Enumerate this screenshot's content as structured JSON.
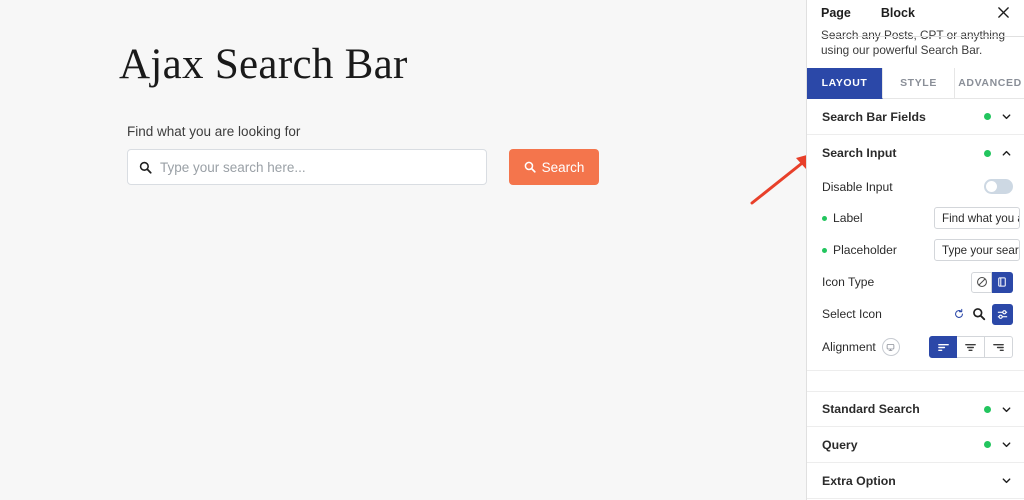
{
  "canvas": {
    "title": "Ajax Search Bar",
    "form": {
      "label": "Find what you are looking for",
      "placeholder": "Type your search here...",
      "search_button": "Search",
      "search_icon": "magnifier-icon"
    }
  },
  "annotation": {
    "arrow_color": "#e8402a",
    "points_to": "Search Input"
  },
  "panel": {
    "tabs_top": [
      {
        "label": "Page",
        "active": false
      },
      {
        "label": "Block",
        "active": true
      }
    ],
    "close_icon": "close-icon",
    "description": {
      "line1": "Search any Posts, CPT or anything",
      "line2": "using our powerful Search Bar."
    },
    "tabbar": [
      {
        "label": "LAYOUT",
        "active": true
      },
      {
        "label": "STYLE",
        "active": false
      },
      {
        "label": "ADVANCED",
        "active": false
      }
    ],
    "sections": [
      {
        "title": "Search Bar Fields",
        "dot": true,
        "expanded": false,
        "chevron": "chevron-down-icon"
      },
      {
        "title": "Search Input",
        "dot": true,
        "expanded": true,
        "chevron": "chevron-up-icon"
      },
      {
        "title": "Standard Search",
        "dot": true,
        "expanded": false,
        "chevron": "chevron-down-icon"
      },
      {
        "title": "Query",
        "dot": true,
        "expanded": false,
        "chevron": "chevron-down-icon"
      },
      {
        "title": "Extra Option",
        "dot": false,
        "expanded": false,
        "chevron": "chevron-down-icon"
      }
    ],
    "search_input_rows": {
      "disable_input": {
        "label": "Disable Input",
        "value": "off"
      },
      "label_field": {
        "label": "Label",
        "value": "Find what you a",
        "bullet": true
      },
      "placeholder_field": {
        "label": "Placeholder",
        "value": "Type your searc",
        "bullet": true
      },
      "icon_type": {
        "label": "Icon Type",
        "options": [
          {
            "icon": "ban-icon",
            "active": false
          },
          {
            "icon": "book-icon",
            "active": true
          }
        ]
      },
      "select_icon": {
        "label": "Select Icon",
        "reset_icon": "reset-icon",
        "preview_icon": "magnifier-icon",
        "picker": {
          "icon": "sliders-icon",
          "active": true
        }
      },
      "alignment": {
        "label": "Alignment",
        "responsive_icon": "desktop-icon",
        "options": [
          {
            "icon": "align-left-icon",
            "active": true
          },
          {
            "icon": "align-center-icon",
            "active": false
          },
          {
            "icon": "align-right-icon",
            "active": false
          }
        ]
      }
    }
  },
  "colors": {
    "accent_blue": "#2b48a8",
    "accent_orange": "#f4754a",
    "status_green": "#22c55e",
    "arrow_red": "#e8402a",
    "canvas_bg": "#f7f7f7"
  }
}
